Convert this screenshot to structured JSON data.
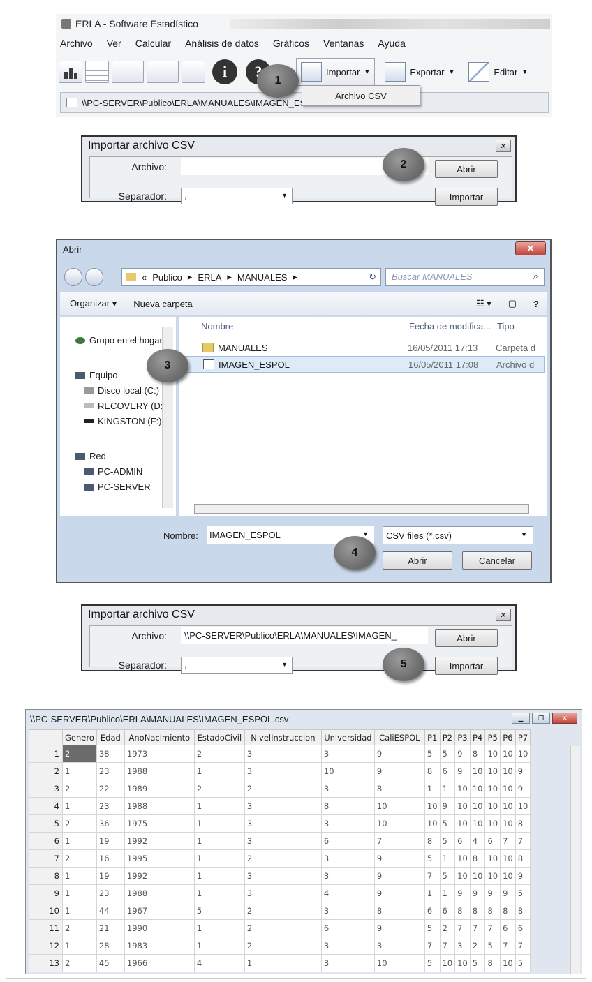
{
  "erla": {
    "title": "ERLA - Software Estadístico",
    "menu": [
      "Archivo",
      "Ver",
      "Calcular",
      "Análisis de datos",
      "Gráficos",
      "Ventanas",
      "Ayuda"
    ],
    "toolbar": {
      "importar": "Importar",
      "exportar": "Exportar",
      "editar": "Editar"
    },
    "dropdown_item": "Archivo CSV",
    "path": "\\\\PC-SERVER\\Publico\\ERLA\\MANUALES\\IMAGEN_ESPOL.csv"
  },
  "steps": [
    "1",
    "2",
    "3",
    "4",
    "5"
  ],
  "import_dialog_1": {
    "title": "Importar archivo CSV",
    "archivo_label": "Archivo:",
    "archivo_value": "",
    "separador_label": "Separador:",
    "separador_value": ",",
    "abrir_btn": "Abrir",
    "importar_btn": "Importar"
  },
  "open_dialog": {
    "title": "Abrir",
    "breadcrumb": [
      "«",
      "Publico",
      "ERLA",
      "MANUALES"
    ],
    "search_placeholder": "Buscar MANUALES",
    "organizar": "Organizar",
    "nueva_carpeta": "Nueva carpeta",
    "sidebar": [
      "Grupo en el hogar",
      "Equipo",
      "Disco local (C:)",
      "RECOVERY (D:)",
      "KINGSTON (F:)",
      "Red",
      "PC-ADMIN",
      "PC-SERVER"
    ],
    "columns": {
      "nombre": "Nombre",
      "fecha": "Fecha de modifica...",
      "tipo": "Tipo"
    },
    "files": [
      {
        "name": "MANUALES",
        "date": "16/05/2011 17:13",
        "type": "Carpeta d"
      },
      {
        "name": "IMAGEN_ESPOL",
        "date": "16/05/2011 17:08",
        "type": "Archivo d"
      }
    ],
    "nombre_label": "Nombre:",
    "nombre_value": "IMAGEN_ESPOL",
    "filter": "CSV files (*.csv)",
    "abrir_btn": "Abrir",
    "cancelar_btn": "Cancelar"
  },
  "import_dialog_2": {
    "title": "Importar archivo CSV",
    "archivo_label": "Archivo:",
    "archivo_value": "\\\\PC-SERVER\\Publico\\ERLA\\MANUALES\\IMAGEN_",
    "separador_label": "Separador:",
    "separador_value": ",",
    "abrir_btn": "Abrir",
    "importar_btn": "Importar"
  },
  "data_window": {
    "title": "\\\\PC-SERVER\\Publico\\ERLA\\MANUALES\\IMAGEN_ESPOL.csv",
    "columns": [
      "Genero",
      "Edad",
      "AnoNacimiento",
      "EstadoCivil",
      "NivelInstruccion",
      "Universidad",
      "CaliESPOL",
      "P1",
      "P2",
      "P3",
      "P4",
      "P5",
      "P6",
      "P7"
    ],
    "rows": [
      [
        "1",
        "2",
        "38",
        "1973",
        "2",
        "3",
        "3",
        "9",
        "5",
        "5",
        "9",
        "8",
        "10",
        "10",
        "10"
      ],
      [
        "2",
        "1",
        "23",
        "1988",
        "1",
        "3",
        "10",
        "9",
        "8",
        "6",
        "9",
        "10",
        "10",
        "10",
        "9"
      ],
      [
        "3",
        "2",
        "22",
        "1989",
        "2",
        "2",
        "3",
        "8",
        "1",
        "1",
        "10",
        "10",
        "10",
        "10",
        "9"
      ],
      [
        "4",
        "1",
        "23",
        "1988",
        "1",
        "3",
        "8",
        "10",
        "10",
        "9",
        "10",
        "10",
        "10",
        "10",
        "10"
      ],
      [
        "5",
        "2",
        "36",
        "1975",
        "1",
        "3",
        "3",
        "10",
        "10",
        "5",
        "10",
        "10",
        "10",
        "10",
        "8"
      ],
      [
        "6",
        "1",
        "19",
        "1992",
        "1",
        "3",
        "6",
        "7",
        "8",
        "5",
        "6",
        "4",
        "6",
        "7",
        "7"
      ],
      [
        "7",
        "2",
        "16",
        "1995",
        "1",
        "2",
        "3",
        "9",
        "5",
        "1",
        "10",
        "8",
        "10",
        "10",
        "8"
      ],
      [
        "8",
        "1",
        "19",
        "1992",
        "1",
        "3",
        "3",
        "9",
        "7",
        "5",
        "10",
        "10",
        "10",
        "10",
        "9"
      ],
      [
        "9",
        "1",
        "23",
        "1988",
        "1",
        "3",
        "4",
        "9",
        "1",
        "1",
        "9",
        "9",
        "9",
        "9",
        "5"
      ],
      [
        "10",
        "1",
        "44",
        "1967",
        "5",
        "2",
        "3",
        "8",
        "6",
        "6",
        "8",
        "8",
        "8",
        "8",
        "8"
      ],
      [
        "11",
        "2",
        "21",
        "1990",
        "1",
        "2",
        "6",
        "9",
        "5",
        "2",
        "7",
        "7",
        "7",
        "6",
        "6"
      ],
      [
        "12",
        "1",
        "28",
        "1983",
        "1",
        "2",
        "3",
        "3",
        "7",
        "7",
        "3",
        "2",
        "5",
        "7",
        "7"
      ],
      [
        "13",
        "2",
        "45",
        "1966",
        "4",
        "1",
        "3",
        "10",
        "5",
        "10",
        "10",
        "5",
        "8",
        "10",
        "5"
      ]
    ]
  }
}
